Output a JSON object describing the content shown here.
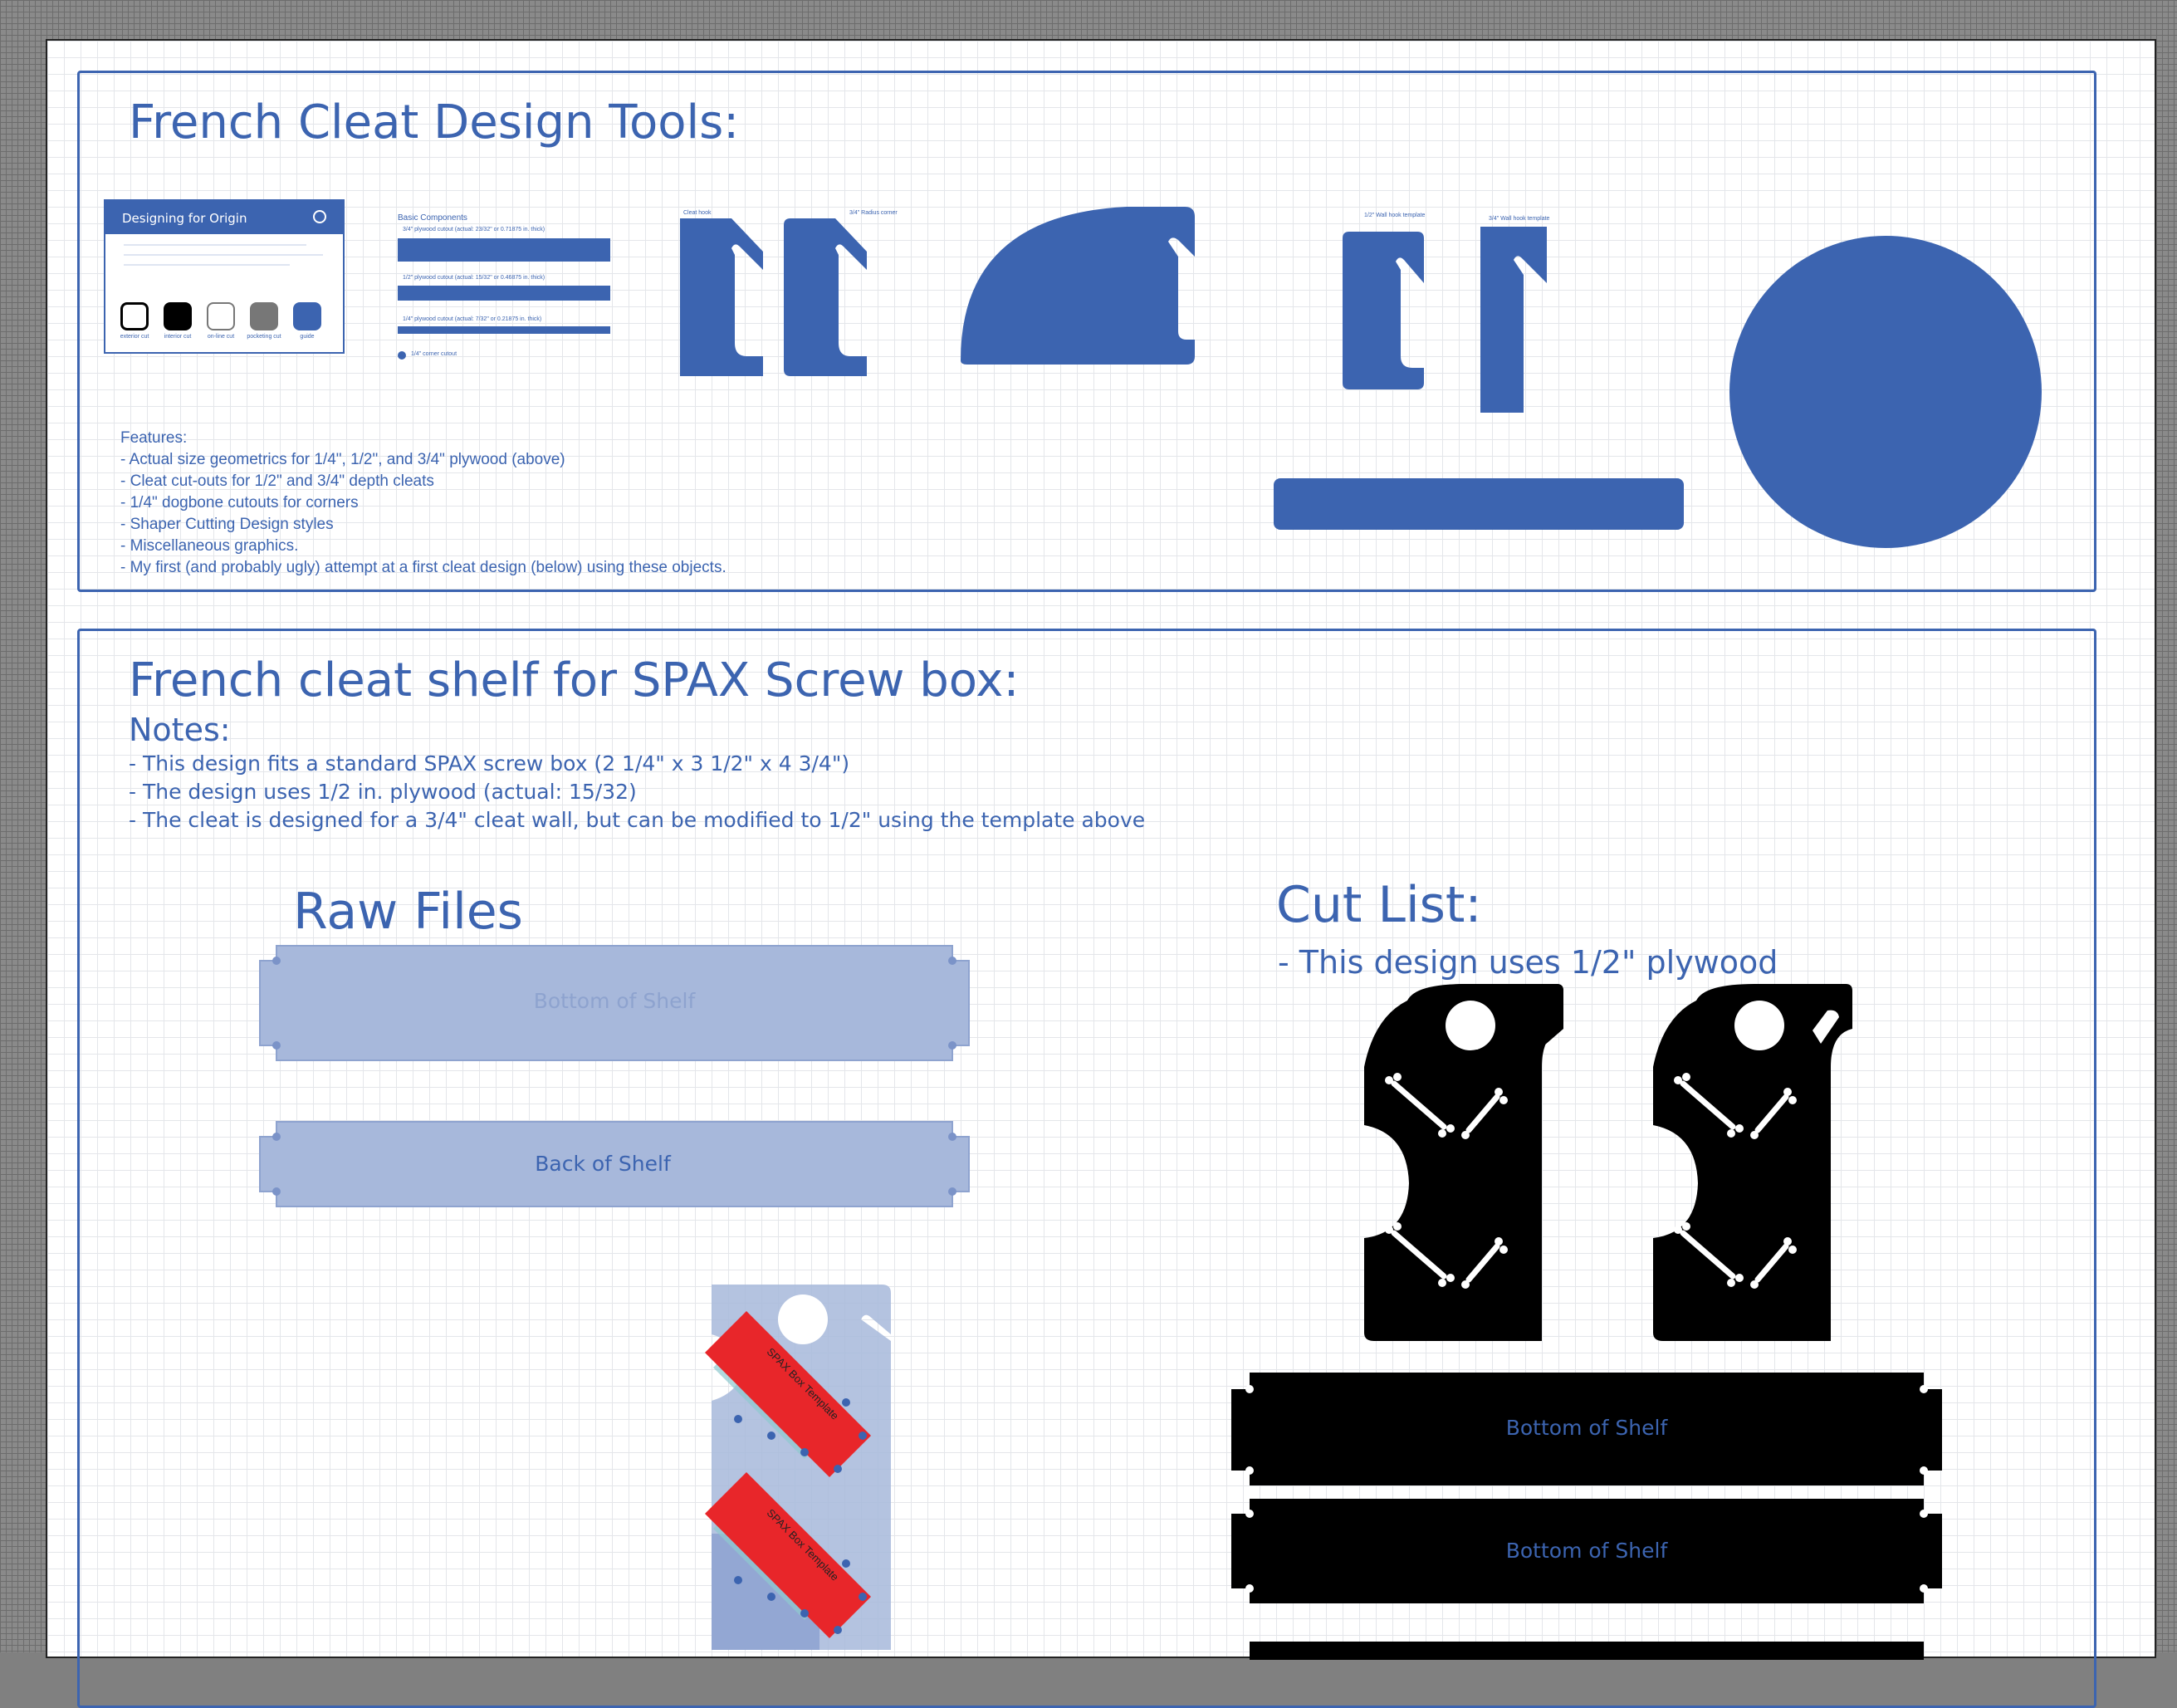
{
  "section1": {
    "title": "French Cleat Design Tools:",
    "features_header": "Features:",
    "features": [
      "- Actual size geometrics for 1/4\", 1/2\", and 3/4\" plywood (above)",
      "- Cleat cut-outs for 1/2\" and 3/4\" depth cleats",
      "- 1/4\" dogbone cutouts for corners",
      "- Shaper Cutting Design styles",
      "- Miscellaneous graphics.",
      "- My first (and probably ugly) attempt at a first cleat design (below) using these objects."
    ],
    "card": {
      "title": "Designing for Origin",
      "swatch_labels": [
        "exterior cut",
        "interior cut",
        "on-line cut",
        "pocketing cut",
        "guide"
      ]
    },
    "components": {
      "header": "Basic Components",
      "items": [
        "3/4\" plywood cutout (actual: 23/32\" or 0.71875 in. thick)",
        "1/2\" plywood cutout (actual: 15/32\" or 0.46875 in. thick)",
        "1/4\" plywood cutout (actual: 7/32\" or 0.21875 in. thick)"
      ],
      "dot_label": "1/4\" corner cutout"
    },
    "hook_labels": [
      "Cleat hook",
      "3/4\" Radius corner"
    ],
    "wall_hook_labels": [
      "1/2\" Wall hook template",
      "3/4\" Wall hook template"
    ]
  },
  "section2": {
    "title": "French cleat shelf for SPAX Screw box:",
    "notes_header": "Notes:",
    "notes": [
      "- This design fits a standard SPAX screw box (2 1/4\" x 3 1/2\" x 4 3/4\")",
      "- The design uses 1/2 in. plywood (actual: 15/32)",
      "- The cleat is designed for a 3/4\" cleat wall, but can be modified to 1/2\" using the template above"
    ],
    "raw_files": {
      "title": "Raw Files",
      "bottom_label": "Bottom of Shelf",
      "back_label": "Back of Shelf",
      "template_label_1": "SPAX Box Template",
      "template_label_2": "SPAX Box Template"
    },
    "cut_list": {
      "title": "Cut List:",
      "subtitle": "- This design uses 1/2\" plywood",
      "panel_labels": [
        "Bottom of Shelf",
        "Bottom of Shelf"
      ]
    }
  },
  "colors": {
    "accent": "#3c64b0",
    "cut_black": "#000000",
    "template_red": "#e8262a",
    "raw_fill": "#a7b8db"
  }
}
